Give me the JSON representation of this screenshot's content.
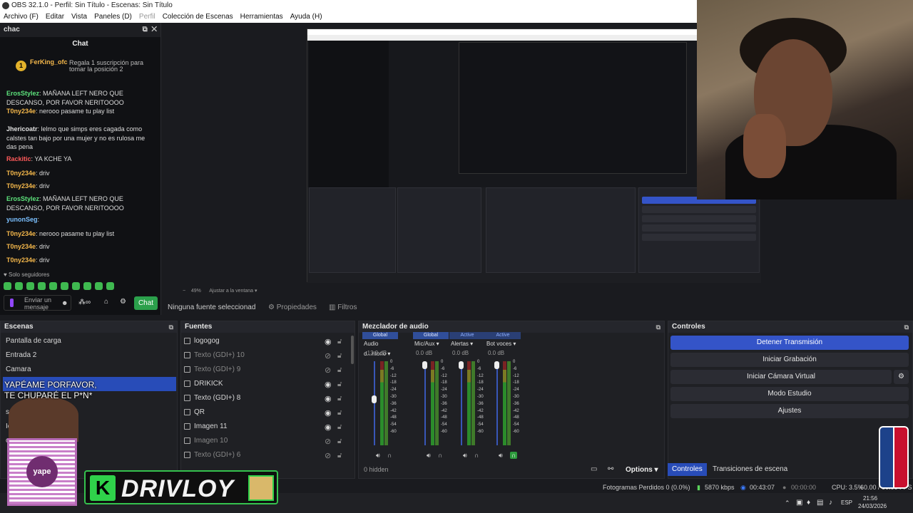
{
  "app": {
    "title": "OBS 32.1.0 - Perfil: Sin Título - Escenas: Sin Título",
    "menu": [
      "Archivo (F)",
      "Editar",
      "Vista",
      "Paneles (D)",
      "Perfil",
      "Colección de Escenas",
      "Herramientas",
      "Ayuda (H)"
    ]
  },
  "chat_dock": {
    "title": "chac",
    "header": "Chat",
    "gift_user": "FerKing_ofc",
    "gift_badge": "1",
    "gift_text": "Regala 1 suscripción para tomar la posición 2",
    "messages": [
      {
        "user": "ErosStylez",
        "text": "MAÑANA LEFT NERO QUE DESCANSO, POR FAVOR NERITOOOO",
        "color": "u1"
      },
      {
        "user": "T0ny234e",
        "text": "nerooo pasame tu play list",
        "color": "u2"
      },
      {
        "user": "Jhericoatr",
        "text": "lelmo que simps eres cagada como calstes tan bajo por una mujer y no es rulosa me das pena",
        "color": "u5"
      },
      {
        "user": "Rackitic",
        "text": "YA KCHE YA",
        "color": "u3"
      },
      {
        "user": "T0ny234e",
        "text": "driv",
        "color": "u2"
      },
      {
        "user": "T0ny234e",
        "text": "driv",
        "color": "u2"
      },
      {
        "user": "ErosStylez",
        "text": "MAÑANA LEFT NERO QUE DESCANSO, POR FAVOR NERITOOOO",
        "color": "u1"
      },
      {
        "user": "yunonSeg",
        "text": "",
        "color": "u4"
      },
      {
        "user": "T0ny234e",
        "text": "nerooo pasame tu play list",
        "color": "u2"
      },
      {
        "user": "T0ny234e",
        "text": "driv",
        "color": "u2"
      },
      {
        "user": "T0ny234e",
        "text": "driv",
        "color": "u2"
      }
    ],
    "followers_only": "Solo seguidores",
    "input_placeholder": "Enviar un mensaje",
    "chat_button": "Chat"
  },
  "preview_bar": {
    "zoom": "49%",
    "fit": "Ajustar a la ventana"
  },
  "source_toolbar": {
    "no_source": "Ninguna fuente seleccionad",
    "properties": "Propiedades",
    "filters": "Filtros"
  },
  "scenes": {
    "title": "Escenas",
    "items": [
      "Pantalla de carga",
      "Entrada 2",
      "Camara",
      "",
      "samsung",
      "Icon",
      "c"
    ]
  },
  "sources": {
    "title": "Fuentes",
    "items": [
      {
        "name": "logogog",
        "dim": false
      },
      {
        "name": "Texto (GDI+) 10",
        "dim": true
      },
      {
        "name": "Texto (GDI+) 9",
        "dim": true
      },
      {
        "name": "DRIKICK",
        "dim": false
      },
      {
        "name": "Texto (GDI+) 8",
        "dim": false
      },
      {
        "name": "QR",
        "dim": false
      },
      {
        "name": "Imagen 11",
        "dim": false
      },
      {
        "name": "Imagen 10",
        "dim": true
      },
      {
        "name": "Texto (GDI+) 6",
        "dim": true
      }
    ]
  },
  "mixer": {
    "title": "Mezclador de audio",
    "channels": [
      {
        "tag": "Global",
        "name": "Audio d...ritorio",
        "db": "-13.9 dB",
        "level": 0.55
      },
      {
        "tag": "Global",
        "name": "Mic/Aux",
        "db": "0.0 dB",
        "level": 1.0
      },
      {
        "tag": "Active",
        "name": "Alertas",
        "db": "0.0 dB",
        "level": 1.0
      },
      {
        "tag": "Active",
        "name": "Bot voces",
        "db": "0.0 dB",
        "level": 1.0
      }
    ],
    "scale": [
      "0",
      "-6",
      "-12",
      "-18",
      "-24",
      "-30",
      "-36",
      "-42",
      "-48",
      "-54",
      "-60"
    ],
    "hidden": "0 hidden",
    "options": "Options"
  },
  "controls": {
    "title": "Controles",
    "buttons": [
      "Detener Transmisión",
      "Iniciar Grabación",
      "Iniciar Cámara Virtual",
      "Modo Estudio",
      "Ajustes"
    ]
  },
  "tabs": [
    "Controles",
    "Transiciones de escena"
  ],
  "status": {
    "dropped": "Fotogramas Perdidos 0 (0.0%)",
    "kbps": "5870 kbps",
    "stream_time": "00:43:07",
    "rec_time": "00:00:00",
    "cpu": "CPU: 3.5%",
    "fps": "60.00 / 60.00 FPS"
  },
  "taskbar": {
    "lang": "ESP",
    "time": "21:56",
    "date": "24/03/2026"
  },
  "overlay": {
    "line1": "YAPÉAME PORFAVOR,",
    "line2": "TE CHUPARÉ  EL P*N*",
    "brand": "DRIVLOY",
    "qr_label": "yape"
  },
  "colors": {
    "accent": "#3454c8",
    "brand_green": "#2fd24a"
  }
}
